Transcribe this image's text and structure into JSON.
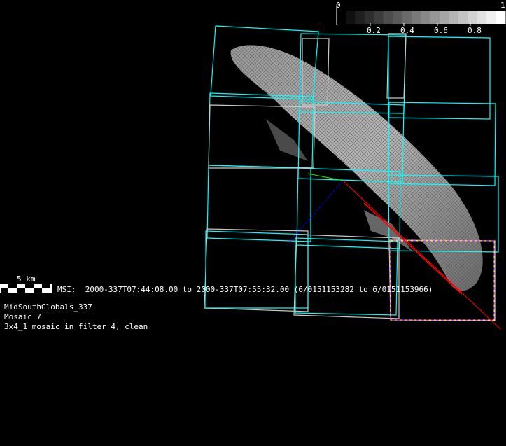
{
  "colorbar": {
    "min_label": "0",
    "max_label": "1",
    "tick_labels": [
      "0.2",
      "0.4",
      "0.6",
      "0.8"
    ],
    "steps": 17
  },
  "scale_bar": {
    "label": "5 km"
  },
  "time_range": "MSI:  2000-337T07:44:08.00 to 2000-337T07:55:32.00 (6/0151153282 to 6/0151153966)",
  "info": {
    "line1": "MidSouthGlobals_337",
    "line2": "Mosaic 7",
    "line3": "3x4_1 mosaic in filter 4, clean"
  },
  "colors": {
    "frame": "#00ffff",
    "frame_old": "#c8c8c8",
    "highlight_a": "#ffff00",
    "highlight_b": "#ff00ff",
    "axis_red": "#ff0000",
    "axis_green": "#00ff00",
    "axis_blue": "#0000ff"
  }
}
